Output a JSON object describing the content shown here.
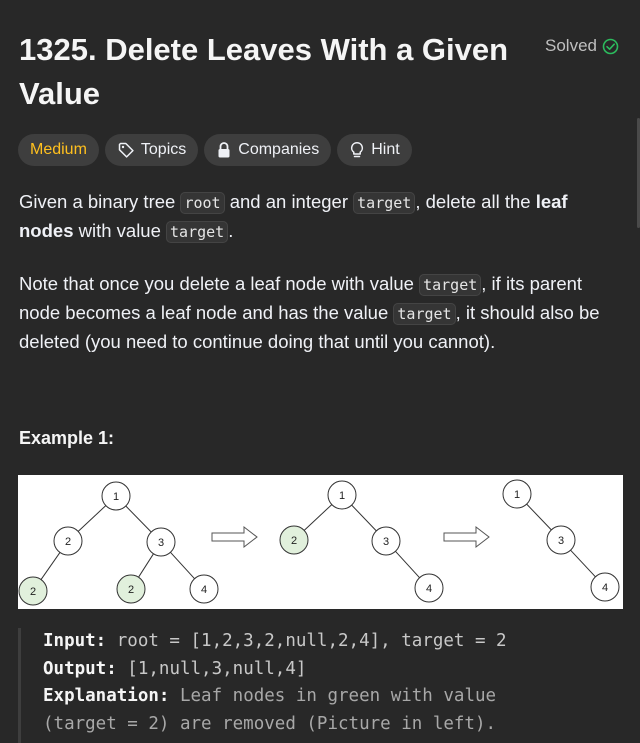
{
  "problem": {
    "title": "1325. Delete Leaves With a Given Value",
    "status": "Solved"
  },
  "tags": {
    "difficulty": "Medium",
    "topics": "Topics",
    "companies": "Companies",
    "hint": "Hint"
  },
  "description": {
    "p1_a": "Given a binary tree ",
    "p1_code1": "root",
    "p1_b": " and an integer ",
    "p1_code2": "target",
    "p1_c": ", delete all the ",
    "p1_bold": "leaf nodes",
    "p1_d": " with value ",
    "p1_code3": "target",
    "p1_e": ".",
    "p2_a": "Note that once you delete a leaf node with value ",
    "p2_code1": "target",
    "p2_b": ", if its parent node becomes a leaf node and has the value ",
    "p2_code2": "target",
    "p2_c": ", it should also be deleted (you need to continue doing that until you cannot)."
  },
  "example": {
    "title": "Example 1:",
    "input_label": "Input:",
    "input_value": " root = [1,2,3,2,null,2,4], target = 2",
    "output_label": "Output:",
    "output_value": " [1,null,3,null,4]",
    "explanation_label": "Explanation:",
    "explanation_value": " Leaf nodes in green with value",
    "explanation_value2": "(target = 2) are removed (Picture in left)."
  },
  "figure": {
    "trees": [
      {
        "nodes": [
          {
            "label": "1",
            "highlight": false
          },
          {
            "label": "2",
            "highlight": false
          },
          {
            "label": "3",
            "highlight": false
          },
          {
            "label": "2",
            "highlight": true
          },
          {
            "label": "2",
            "highlight": true
          },
          {
            "label": "4",
            "highlight": false
          }
        ]
      },
      {
        "nodes": [
          {
            "label": "1",
            "highlight": false
          },
          {
            "label": "2",
            "highlight": true
          },
          {
            "label": "3",
            "highlight": false
          },
          {
            "label": "4",
            "highlight": false
          }
        ]
      },
      {
        "nodes": [
          {
            "label": "1",
            "highlight": false
          },
          {
            "label": "3",
            "highlight": false
          },
          {
            "label": "4",
            "highlight": false
          }
        ]
      }
    ],
    "colors": {
      "highlight_fill": "#e1f0dc",
      "node_stroke": "#333333",
      "arrow_stroke": "#555555"
    }
  },
  "colors": {
    "medium": "#ffc01e",
    "solved_check": "#2cbb5d"
  }
}
